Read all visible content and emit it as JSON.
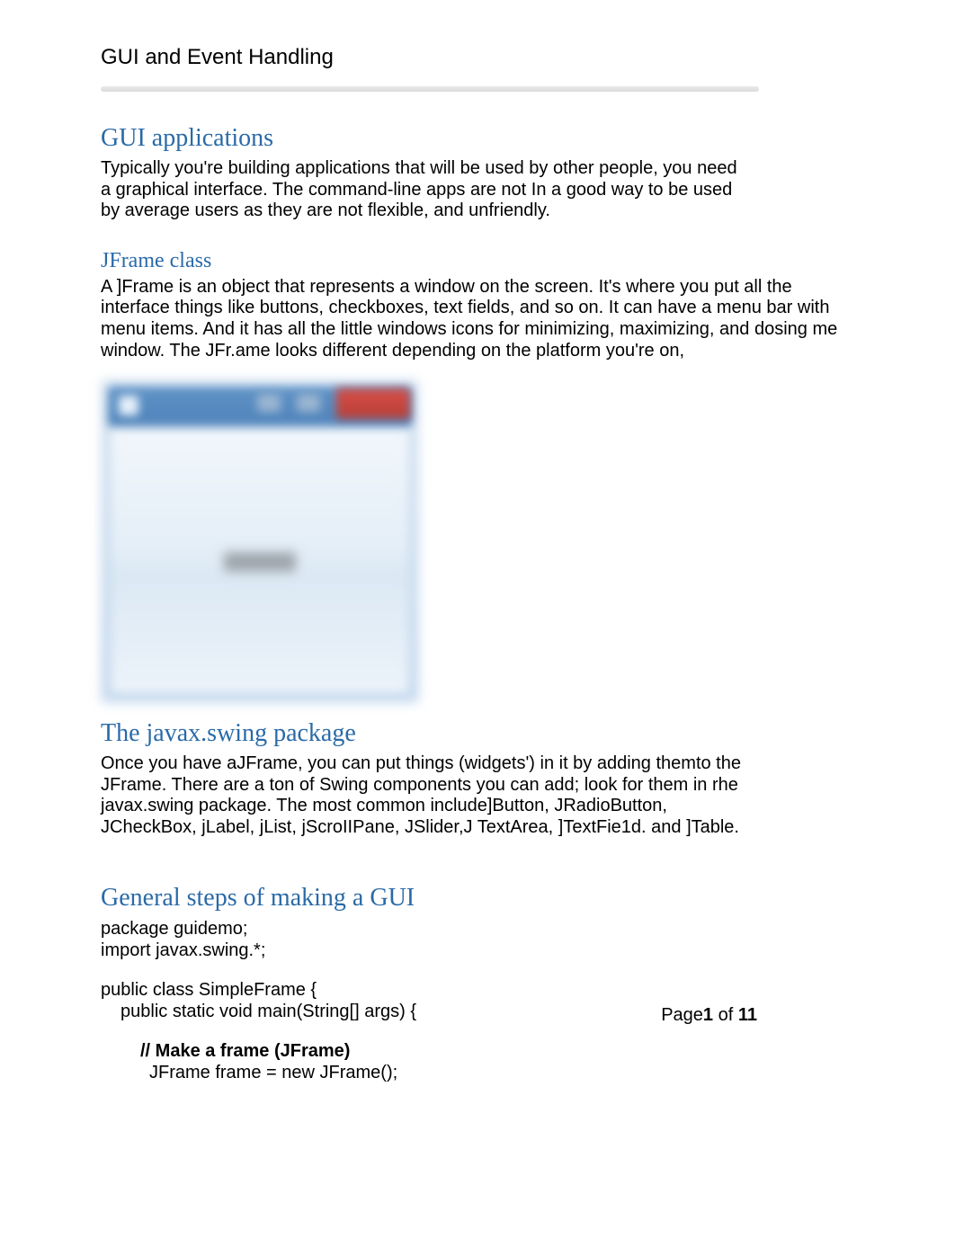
{
  "doc": {
    "title": "GUI and Event Handling"
  },
  "sections": {
    "gui_apps": {
      "heading": "GUI applications",
      "body": "Typically you're building applications that will be used by other people, you need a graphical interface. The command-line apps are not In a good way to be used by average users as they are not flexible, and unfriendly."
    },
    "jframe": {
      "heading": "JFrame class",
      "body": "A ]Frame is an object that represents a window on the screen. It's where you put all the interface things like buttons, checkboxes, text fields, and so on. It can have a menu bar with menu items. And it has all the little windows icons for minimizing, maximizing, and dosing me window. The JFr.ame looks different depending on the platform you're on,"
    },
    "swing": {
      "heading": "The javax.swing package",
      "body": "Once you have aJFrame, you can put things (widgets') in it by adding themto the JFrame. There are a ton of Swing components you can add; look for them in rhe javax.swing package. The most common include]Button, JRadioButton, JCheckBox, jLabel, jList, jScroIIPane, JSlider,J TextArea, ]TextFie1d. and ]Table."
    },
    "steps": {
      "heading": "General steps of making a GUI",
      "code": {
        "l1": "package guidemo;",
        "l2": "import javax.swing.*;",
        "l3": "public class SimpleFrame {",
        "l4": "public static void main(String[] args) {",
        "l5": "// Make a frame (JFrame)",
        "l6": "JFrame frame = new JFrame();"
      }
    }
  },
  "footer": {
    "page_label": "Page",
    "page_current": "1",
    "of": " of ",
    "page_total": "11"
  }
}
